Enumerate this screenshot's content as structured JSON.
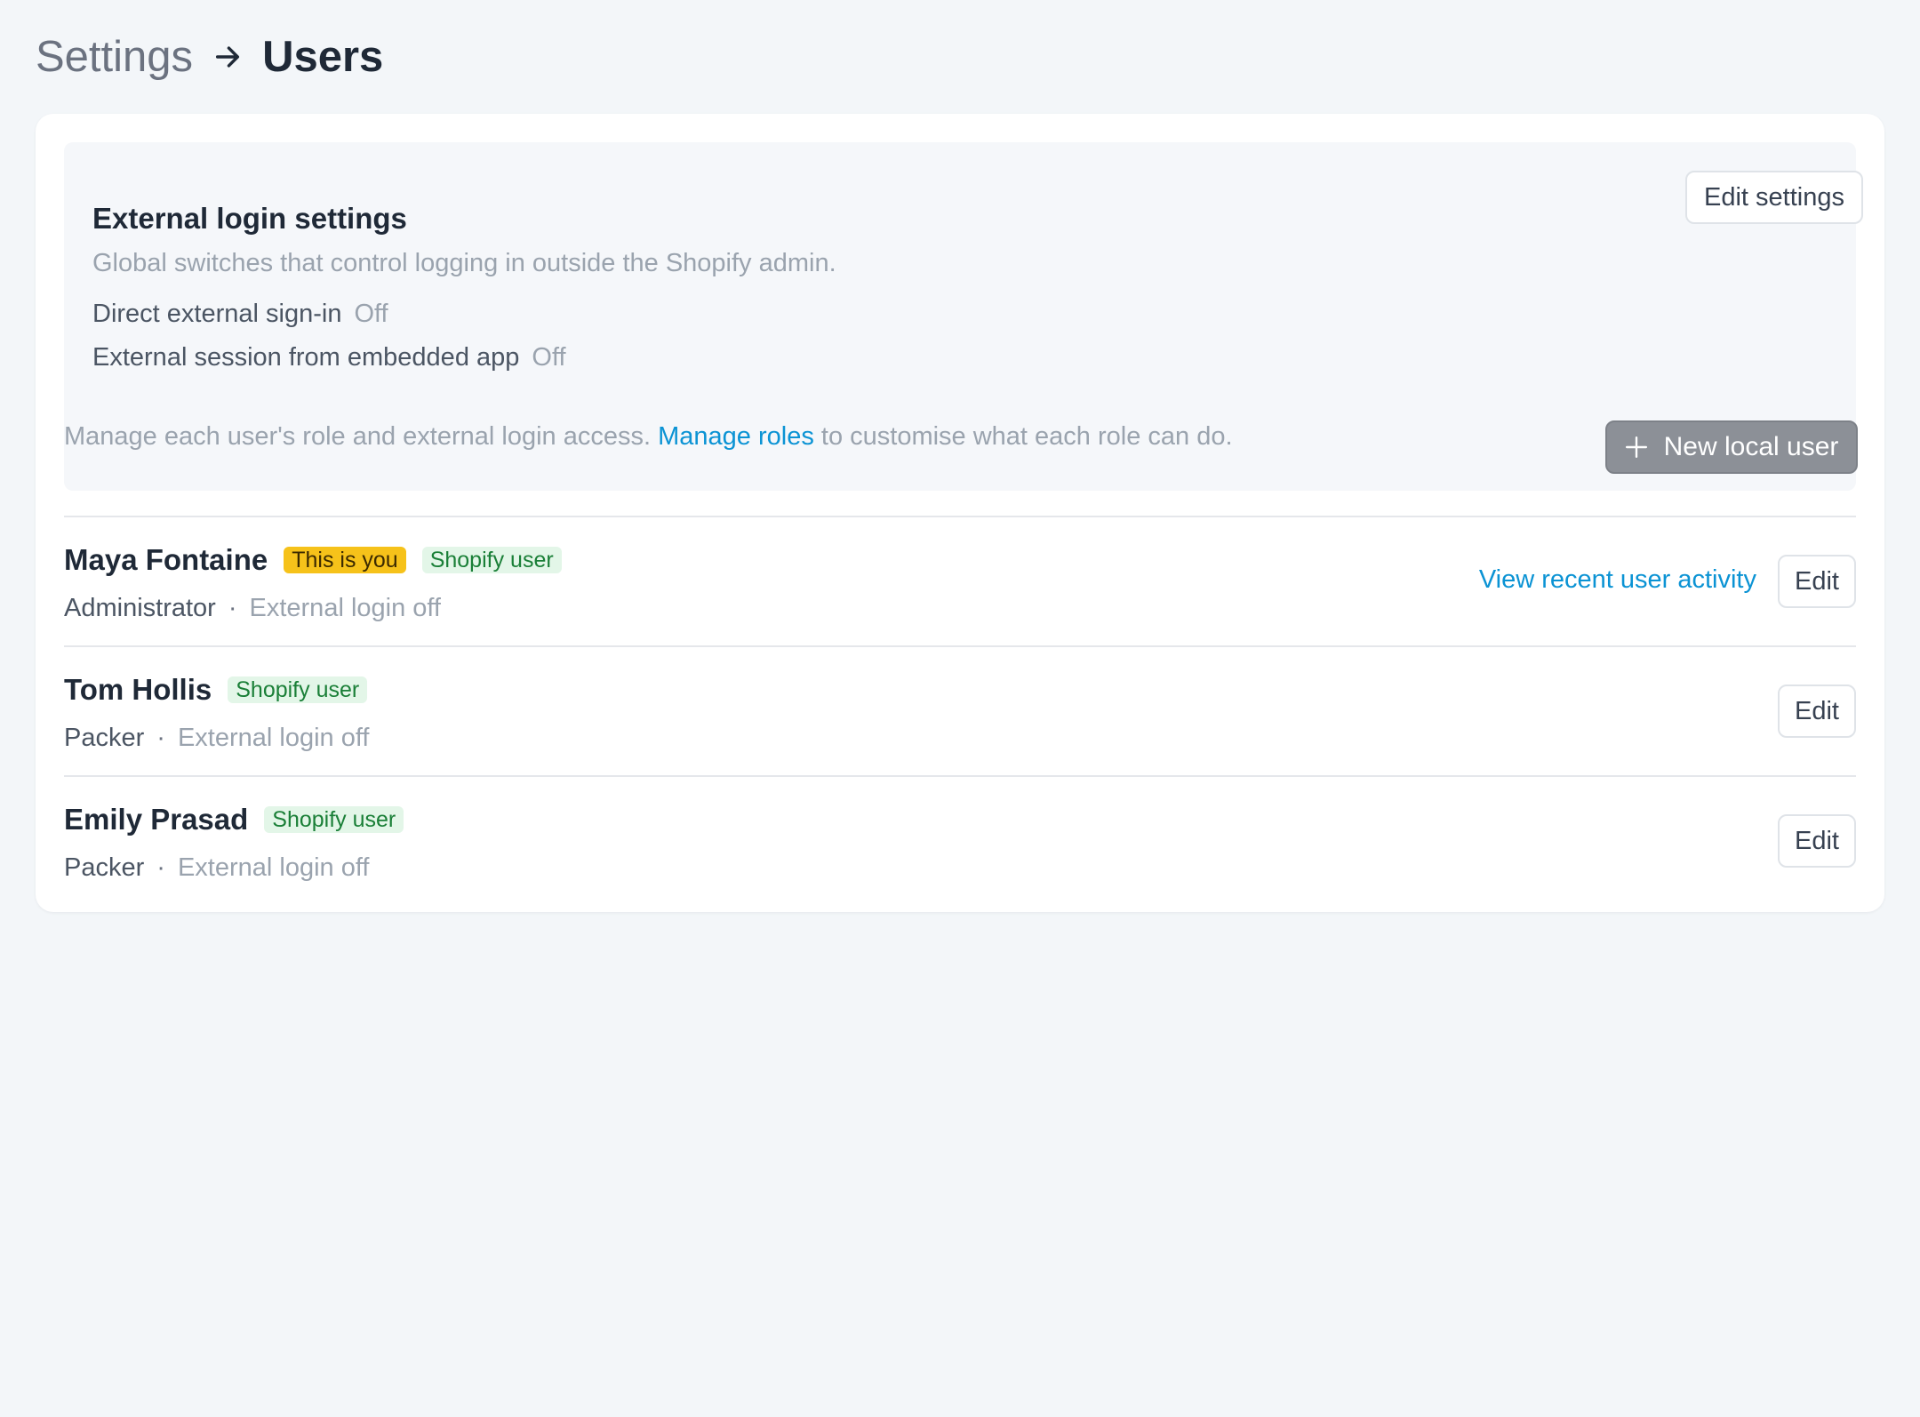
{
  "breadcrumb": {
    "parent": "Settings",
    "current": "Users",
    "separator_icon": "arrow-right-icon"
  },
  "external_login": {
    "title": "External login settings",
    "subtitle": "Global switches that control logging in outside the Shopify admin.",
    "edit_button": "Edit settings",
    "settings": [
      {
        "label": "Direct external sign-in",
        "value": "Off"
      },
      {
        "label": "External session from embedded app",
        "value": "Off"
      }
    ]
  },
  "intro": {
    "text_before": "Manage each user's role and external login access.",
    "link": "Manage roles",
    "text_after": "to customise what each role can do."
  },
  "new_user_button": {
    "label": "New local user",
    "icon": "plus-icon"
  },
  "users": [
    {
      "name": "Maya Fontaine",
      "badges": [
        "This is you",
        "Shopify user"
      ],
      "role": "Administrator",
      "external": "External login off",
      "activity_link": "View recent user activity",
      "edit": "Edit"
    },
    {
      "name": "Tom Hollis",
      "badges": [
        "Shopify user"
      ],
      "role": "Packer",
      "external": "External login off",
      "edit": "Edit"
    },
    {
      "name": "Emily Prasad",
      "badges": [
        "Shopify user"
      ],
      "role": "Packer",
      "external": "External login off",
      "edit": "Edit"
    }
  ],
  "meta_separator": "·",
  "colors": {
    "page_bg": "#f3f6f9",
    "link": "#0b93d4",
    "badge_you": "#f6c21a",
    "badge_shopify_bg": "#e3f6e8",
    "badge_shopify_text": "#1a7f37",
    "primary_button_disabled": "#8c9097"
  }
}
